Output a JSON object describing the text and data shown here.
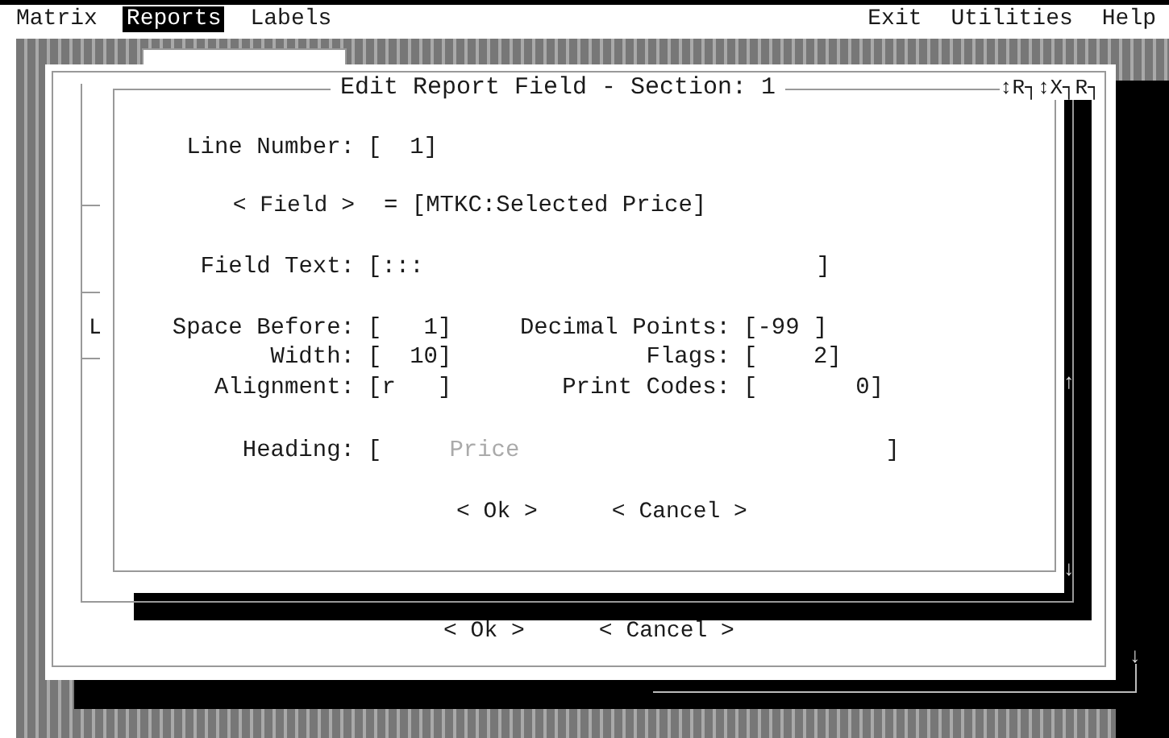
{
  "menu_bar": {
    "left": [
      {
        "label": "Matrix",
        "selected": false
      },
      {
        "label": "Reports",
        "selected": true
      },
      {
        "label": "Labels",
        "selected": false
      }
    ],
    "right": [
      {
        "label": "Exit",
        "selected": false
      },
      {
        "label": "Utilities",
        "selected": false
      },
      {
        "label": "Help",
        "selected": false
      }
    ]
  },
  "back_window": {
    "buttons": [
      "< Ok >",
      "< Cancel >"
    ],
    "scroll_mark": "↓"
  },
  "middle_window": {
    "fragment": "L",
    "scroll_marks": [
      "↑",
      "↓"
    ]
  },
  "dialog": {
    "title": "Edit Report Field - Section: 1",
    "corner": "↕R┐↕X┐R┐",
    "rows": [
      {
        "cells": [
          {
            "kind": "label",
            "text": "Line Number:"
          },
          {
            "kind": "field",
            "value": "[  1]"
          }
        ]
      },
      {
        "cells": [
          {
            "kind": "button",
            "text": "< Field >"
          },
          {
            "kind": "text",
            "text": "= [MTKC:Selected Price]"
          }
        ]
      },
      {
        "cells": [
          {
            "kind": "label",
            "text": "Field Text:"
          },
          {
            "kind": "field",
            "value": "[:::",
            "end": "]"
          }
        ]
      },
      {
        "cells": [
          {
            "kind": "label",
            "text": "Space Before:"
          },
          {
            "kind": "field",
            "value": "[   1]"
          },
          {
            "kind": "label",
            "text": "Decimal Points:"
          },
          {
            "kind": "field",
            "value": "[-99 ]"
          }
        ]
      },
      {
        "cells": [
          {
            "kind": "label",
            "text": "Width:"
          },
          {
            "kind": "field",
            "value": "[  10]"
          },
          {
            "kind": "label",
            "text": "Flags:"
          },
          {
            "kind": "field",
            "value": "[    2]"
          }
        ]
      },
      {
        "cells": [
          {
            "kind": "label",
            "text": "Alignment:"
          },
          {
            "kind": "field",
            "value": "[r   ]"
          },
          {
            "kind": "label",
            "text": "Print Codes:"
          },
          {
            "kind": "field",
            "value": "[       0]"
          }
        ]
      },
      {
        "cells": [
          {
            "kind": "label",
            "text": "Heading:"
          },
          {
            "kind": "field",
            "start": "[",
            "value": "Price",
            "end": "]",
            "dimmed": true
          }
        ]
      }
    ],
    "buttons": [
      "< Ok >",
      "< Cancel >"
    ]
  }
}
